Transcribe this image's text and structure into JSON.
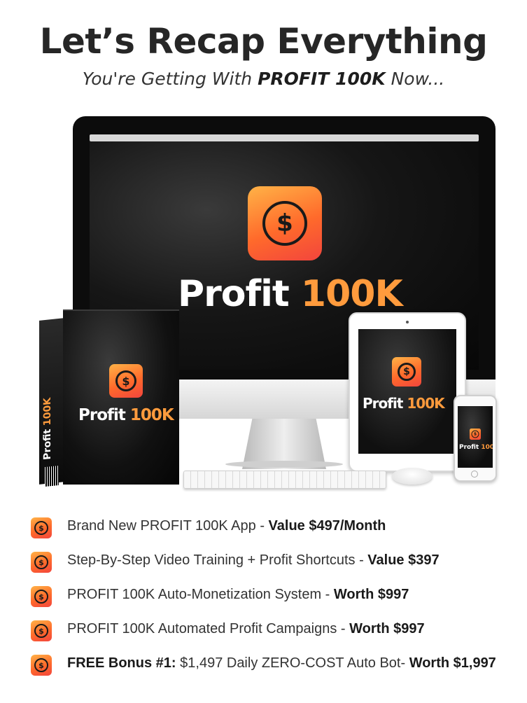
{
  "header": {
    "title": "Let’s Recap Everything",
    "subtitle_prefix": "You're Getting With ",
    "subtitle_bold": "PROFIT 100K",
    "subtitle_suffix": " Now..."
  },
  "product": {
    "brand_word": "Profit",
    "brand_number": "100K",
    "icon": "dollar-coin-icon",
    "accent_color": "#ff9b3d"
  },
  "features": [
    {
      "prefix": "",
      "text": "Brand New PROFIT 100K App - ",
      "value": "Value $497/Month"
    },
    {
      "prefix": "",
      "text": "Step-By-Step Video Training + Profit Shortcuts - ",
      "value": "Value $397"
    },
    {
      "prefix": "",
      "text": "PROFIT 100K Auto-Monetization System - ",
      "value": "Worth $997"
    },
    {
      "prefix": "",
      "text": "PROFIT 100K Automated Profit Campaigns - ",
      "value": "Worth $997"
    },
    {
      "prefix": "FREE Bonus #1: ",
      "text": "$1,497 Daily ZERO-COST Auto Bot- ",
      "value": "Worth $1,997"
    }
  ]
}
